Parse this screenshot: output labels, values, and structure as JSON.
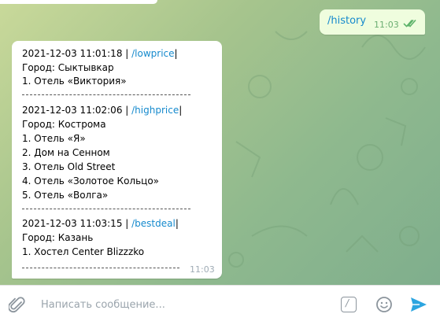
{
  "outgoing_message": {
    "text": "/history",
    "time": "11:03"
  },
  "incoming_message": {
    "entries": [
      {
        "header_prefix": "2021-12-03 11:01:18 | ",
        "command": "/lowprice",
        "header_suffix": "|",
        "city": "Город: Сыктывкар",
        "hotels": [
          "1. Отель «Виктория»"
        ]
      },
      {
        "header_prefix": "2021-12-03 11:02:06 | ",
        "command": "/highprice",
        "header_suffix": "|",
        "city": "Город: Кострома",
        "hotels": [
          "1. Отель «Я»",
          "2. Дом на Сенном",
          "3. Отель Old Street",
          "4. Отель «Золотое Кольцо»",
          "5. Отель «Волга»"
        ]
      },
      {
        "header_prefix": "2021-12-03 11:03:15 | ",
        "command": "/bestdeal",
        "header_suffix": "|",
        "city": "Город: Казань",
        "hotels": [
          "1. Хостел Center Blizzzko"
        ]
      }
    ],
    "time": "11:03"
  },
  "composer": {
    "placeholder": "Написать сообщение...",
    "command_icon_glyph": "/"
  },
  "icons": [
    "paperclip-icon",
    "slash-command-icon",
    "emoji-icon",
    "send-icon",
    "read-checkmarks-icon"
  ],
  "colors": {
    "link": "#168acd",
    "outgoing_bubble": "#effdde",
    "send": "#2ca5e0"
  }
}
